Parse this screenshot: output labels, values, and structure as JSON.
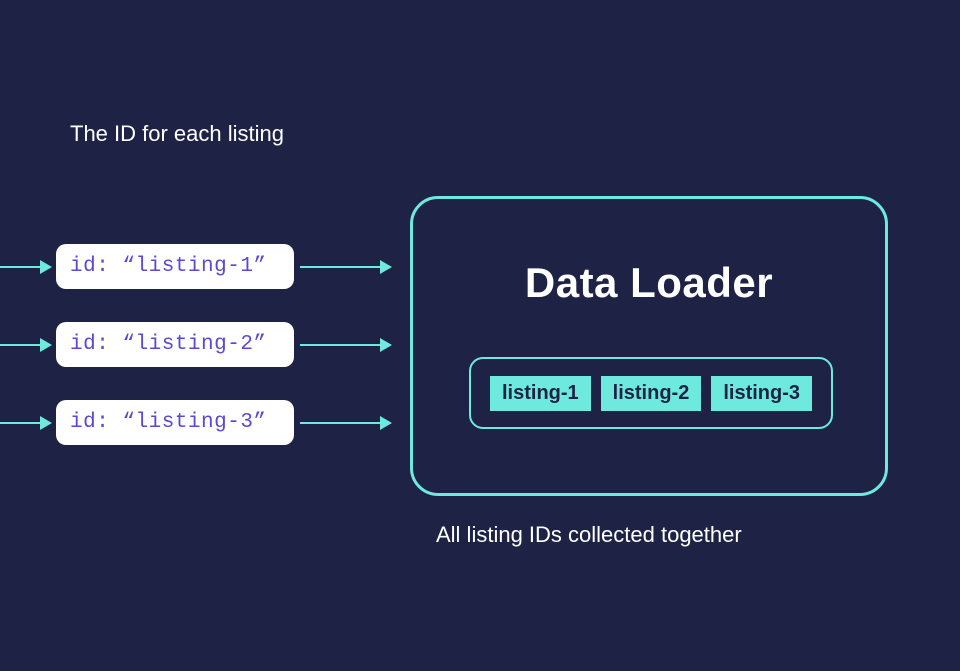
{
  "topLabel": "The ID for each listing",
  "pills": [
    "id: “listing-1”",
    "id: “listing-2”",
    "id: “listing-3”"
  ],
  "loader": {
    "title": "Data Loader",
    "collected": [
      "listing-1",
      "listing-2",
      "listing-3"
    ]
  },
  "bottomLabel": "All listing IDs collected together"
}
